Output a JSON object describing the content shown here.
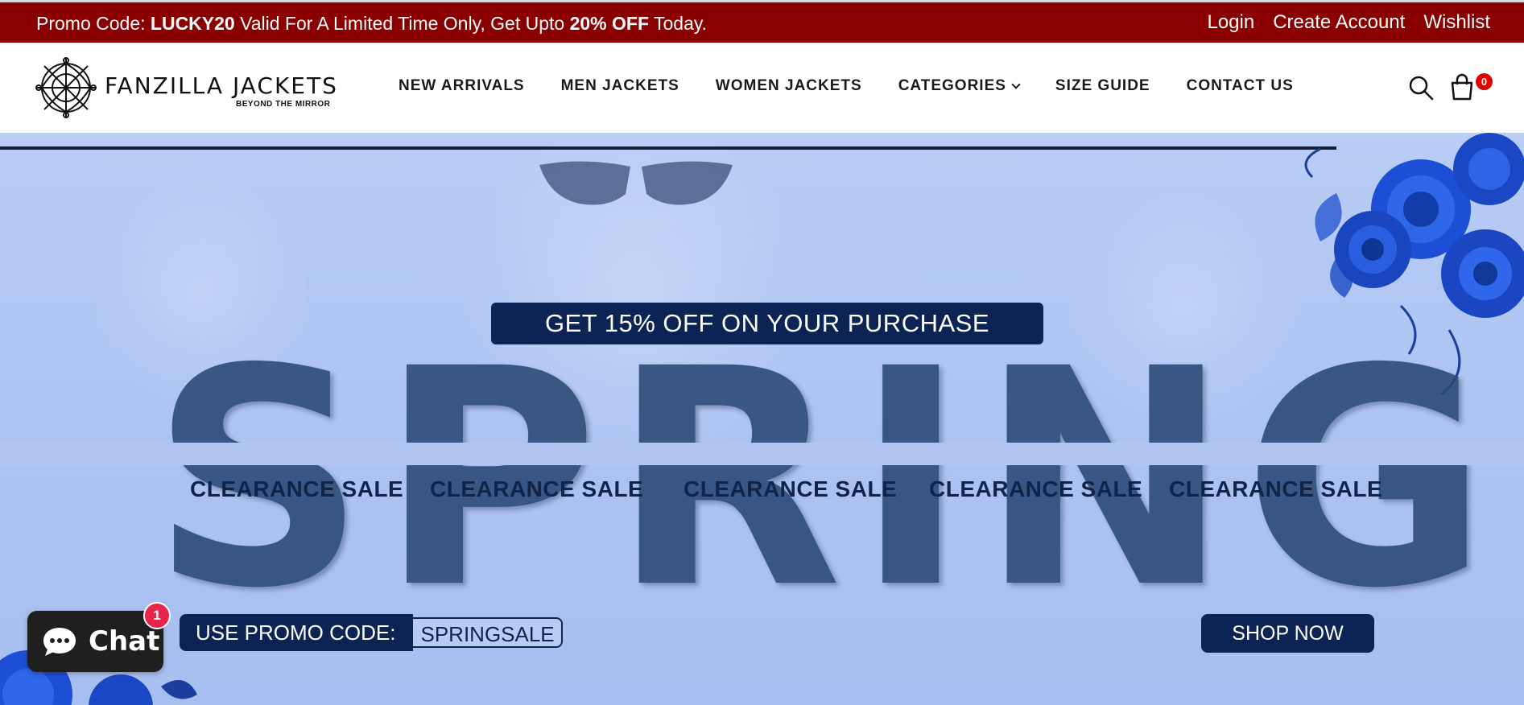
{
  "promo_bar": {
    "text_prefix": "Promo Code: ",
    "code": "LUCKY20",
    "text_middle": " Valid For A Limited Time Only, Get Upto ",
    "discount": "20% OFF",
    "text_suffix": " Today.",
    "links": [
      "Login",
      "Create Account",
      "Wishlist"
    ]
  },
  "header": {
    "logo": {
      "name": "FANZILLA JACKETS",
      "tagline": "BEYOND THE MIRROR"
    },
    "nav": [
      "NEW ARRIVALS",
      "MEN JACKETS",
      "WOMEN JACKETS",
      "CATEGORIES",
      "SIZE GUIDE",
      "CONTACT US"
    ],
    "icons": {
      "search": "search-icon",
      "cart": "shopping-bag-icon"
    },
    "cart_count": "0"
  },
  "hero": {
    "offer": "GET 15% OFF ON YOUR PURCHASE",
    "headline": "SPRING",
    "clearance": [
      "CLEARANCE SALE",
      "CLEARANCE SALE",
      "CLEARANCE SALE",
      "CLEARANCE SALE",
      "CLEARANCE SALE"
    ],
    "promo_label": "USE PROMO CODE:",
    "promo_code": "SPRINGSALE",
    "cta": "SHOP NOW"
  },
  "chat": {
    "label": "Chat",
    "badge": "1",
    "icon": "chat-bubble-icon"
  },
  "colors": {
    "promo_bar": "#8a0000",
    "navy": "#0c2454",
    "hero_bg": "#b1c7f3",
    "rose": "#1d4fd6"
  }
}
